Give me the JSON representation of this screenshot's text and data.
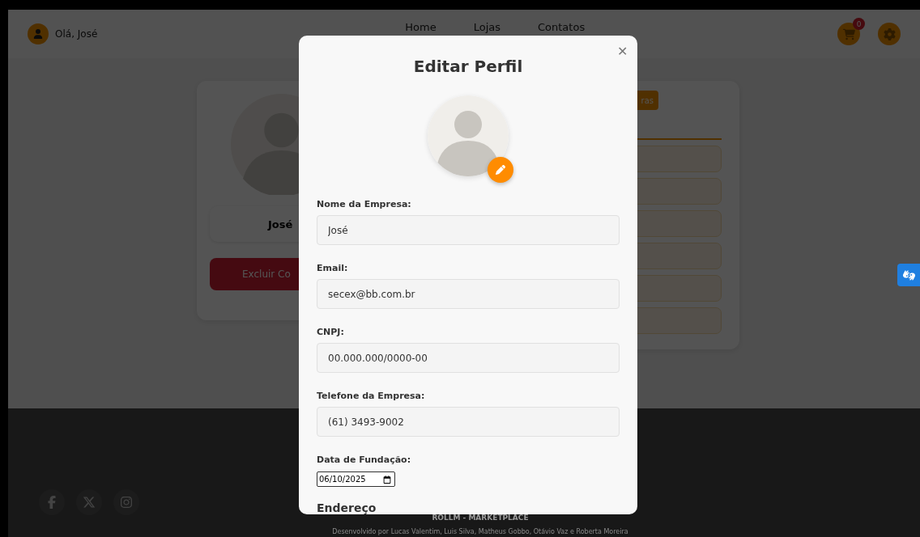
{
  "header": {
    "greeting": "Olá, José",
    "nav": [
      {
        "label": "Home"
      },
      {
        "label": "Lojas"
      },
      {
        "label": "Contatos"
      }
    ],
    "cart_badge": "0"
  },
  "profile_card": {
    "name": "José",
    "delete_button": "Excluir Co"
  },
  "orders_panel": {
    "button": "ras"
  },
  "modal": {
    "title": "Editar Perfil",
    "close": "✕",
    "fields": [
      {
        "kind": "text",
        "label": "Nome da Empresa:",
        "value": "José"
      },
      {
        "kind": "text",
        "label": "Email:",
        "value": "secex@bb.com.br"
      },
      {
        "kind": "text",
        "label": "CNPJ:",
        "value": "00.000.000/0000-00"
      },
      {
        "kind": "text",
        "label": "Telefone da Empresa:",
        "value": "(61) 3493-9002"
      },
      {
        "kind": "date",
        "label": "Data de Fundação:",
        "value": "06/10/2025"
      }
    ],
    "section_heading": "Endereço"
  },
  "footer": {
    "brand": "ROLLM - MARKETPLACE",
    "credits": "Desenvolvido por Lucas Valentim, Luis Silva, Matheus Gobbo, Otávio Vaz e Roberta Moreira"
  }
}
